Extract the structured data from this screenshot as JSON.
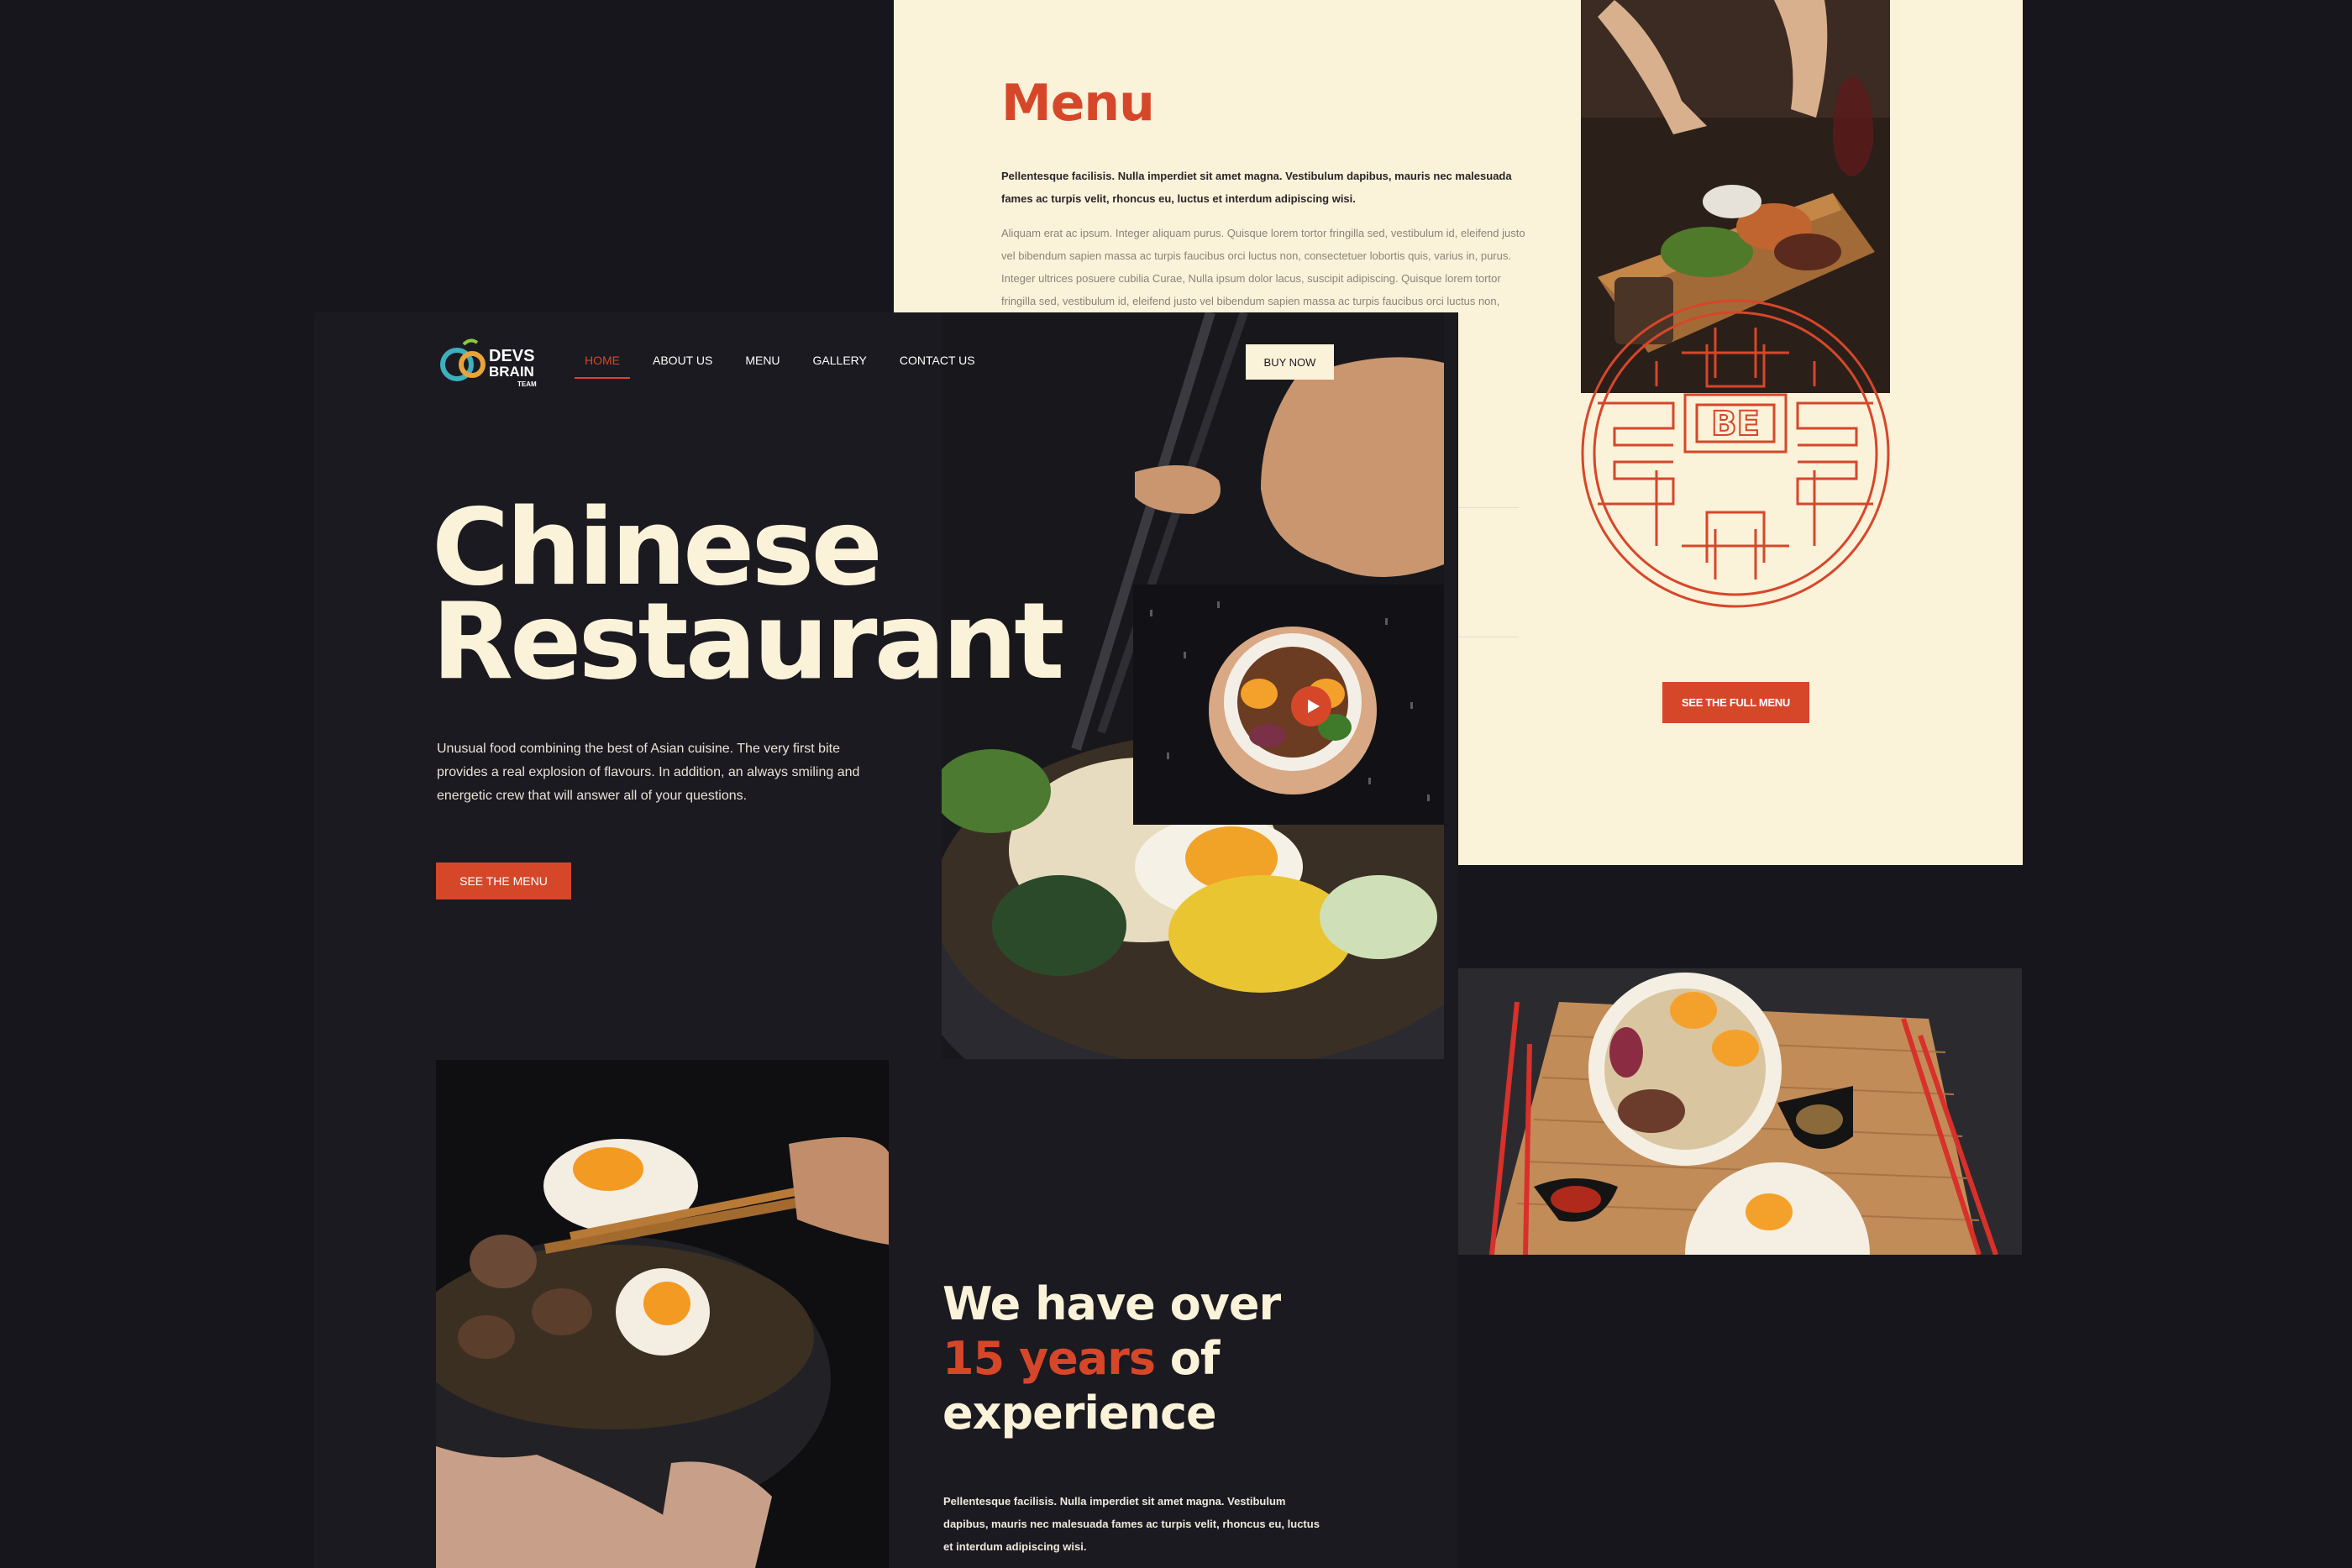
{
  "menu_section": {
    "title": "Menu",
    "lead": "Pellentesque facilisis. Nulla imperdiet sit amet magna. Vestibulum dapibus, mauris nec malesuada fames ac turpis velit, rhoncus eu, luctus et interdum adipiscing wisi.",
    "body": "Aliquam erat ac ipsum. Integer aliquam purus. Quisque lorem tortor fringilla sed, vestibulum id, eleifend justo vel bibendum sapien massa ac turpis faucibus orci luctus non, consectetuer lobortis quis, varius in, purus. Integer ultrices posuere cubilia Curae, Nulla ipsum dolor lacus, suscipit adipiscing. Quisque lorem tortor fringilla sed, vestibulum id, eleifend justo vel bibendum sapien massa ac turpis faucibus orci luctus non, consectetuer lobortis quis, varius in, purus.",
    "emblem_text": "BE",
    "full_menu_label": "SEE THE FULL MENU"
  },
  "logo": {
    "line1": "DEVS",
    "line2": "BRAIN",
    "line3": "TEAM"
  },
  "nav": {
    "items": [
      "HOME",
      "ABOUT US",
      "MENU",
      "GALLERY",
      "CONTACT US"
    ],
    "active": "HOME",
    "buy_label": "BUY NOW"
  },
  "hero": {
    "title_line1": "Chinese",
    "title_line2": "Restaurant",
    "description": "Unusual food combining the best of Asian cuisine. The very first bite provides a real explosion of flavours. In addition, an always smiling and energetic crew that will answer all of your questions.",
    "cta_label": "SEE THE MENU"
  },
  "experience": {
    "line1": "We have over",
    "highlight": "15 years",
    "line2_rest": " of",
    "line3": "experience",
    "body": "Pellentesque facilisis. Nulla imperdiet sit amet magna. Vestibulum dapibus, mauris nec malesuada fames ac turpis velit, rhoncus eu, luctus et interdum adipiscing wisi."
  },
  "colors": {
    "accent": "#d6472a",
    "cream": "#fbf2da",
    "dark": "#1b1a20",
    "background": "#17161c"
  },
  "icons": {
    "play": "play-icon"
  }
}
